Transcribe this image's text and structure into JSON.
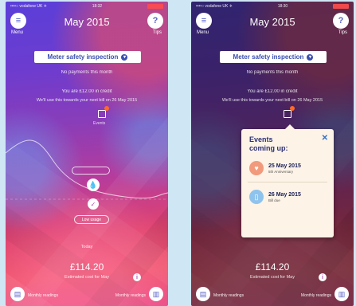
{
  "screens": [
    {
      "status": {
        "carrier": "••••○ vodafone UK ✈",
        "time": "18:32"
      },
      "menu_label": "Menu",
      "tips_label": "Tips",
      "title": "May 2015",
      "bill_label": "Meter safety inspection",
      "line1": "No payments this month",
      "line2": "You are £12.00 in credit",
      "line3": "We'll use this towards your next bill on 26 May 2015",
      "calendar_label": "Events",
      "pill_small": "",
      "pill_medium": "Low usage",
      "today_label": "Today",
      "amount": "£114.20",
      "amount_sub": "Estimated cost for May",
      "foot_left": "Monthly readings",
      "foot_right": "Monthly readings",
      "ticks": [
        "",
        "",
        "",
        "",
        "",
        "",
        "",
        "",
        ""
      ]
    },
    {
      "status": {
        "carrier": "••••○ vodafone UK ✈",
        "time": "18:30"
      },
      "menu_label": "Menu",
      "tips_label": "Tips",
      "title": "May 2015",
      "bill_label": "Meter safety inspection",
      "line1": "No payments this month",
      "line2": "You are £12.00 in credit",
      "line3": "We'll use this towards your next bill on 26 May 2015",
      "amount": "£114.20",
      "amount_sub": "Estimated cost for May",
      "foot_left": "Monthly readings",
      "foot_right": "Monthly readings",
      "popup": {
        "title": "Events coming up:",
        "close": "✕",
        "events": [
          {
            "date": "25 May 2015",
            "desc": "5th Anniversary",
            "icon": "heart-icon"
          },
          {
            "date": "26 May 2015",
            "desc": "Bill due",
            "icon": "document-icon"
          }
        ]
      }
    }
  ],
  "colors": {
    "accent": "#5a63c8",
    "pill_text": "#3b4fb0",
    "popup_bg": "#fdf3e6"
  }
}
